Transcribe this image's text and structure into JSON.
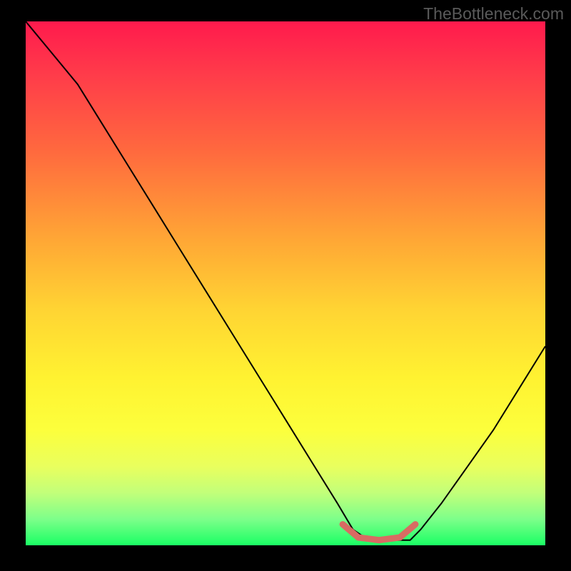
{
  "watermark": "TheBottleneck.com",
  "chart_data": {
    "type": "line",
    "title": "",
    "xlabel": "",
    "ylabel": "",
    "xlim": [
      0,
      100
    ],
    "ylim": [
      0,
      100
    ],
    "background_gradient": {
      "top": "#ff1a4d",
      "bottom": "#1aff64",
      "stops": [
        "red",
        "orange",
        "yellow",
        "green"
      ]
    },
    "series": [
      {
        "name": "main-curve",
        "color": "#000000",
        "x": [
          0,
          5,
          10,
          15,
          20,
          25,
          30,
          35,
          40,
          45,
          50,
          55,
          60,
          63,
          66,
          70,
          74,
          76,
          80,
          85,
          90,
          95,
          100
        ],
        "y": [
          100,
          94,
          88,
          80,
          72,
          64,
          56,
          48,
          40,
          32,
          24,
          16,
          8,
          3,
          1,
          1,
          1,
          3,
          8,
          15,
          22,
          30,
          38
        ]
      },
      {
        "name": "highlight-segment",
        "color": "#d86b63",
        "x": [
          61,
          64,
          68,
          72,
          75
        ],
        "y": [
          4,
          1.5,
          1,
          1.5,
          4
        ]
      }
    ],
    "note": "Axis values are normalized 0-100 estimates; no numeric tick labels are visible in the image."
  }
}
